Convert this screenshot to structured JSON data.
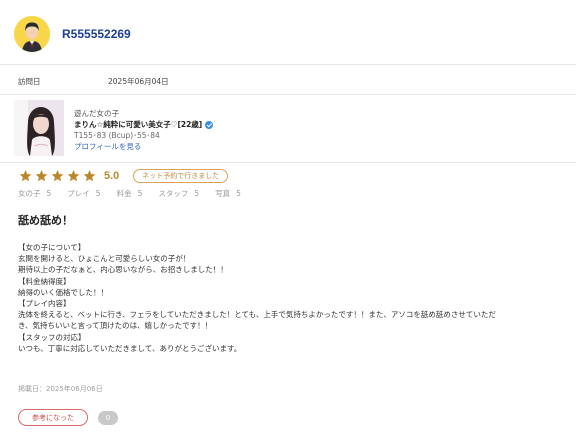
{
  "reviewer": {
    "name": "R555552269",
    "avatar_icon": "user-avatar-icon"
  },
  "visit": {
    "label": "訪問日",
    "date": "2025年06月04日"
  },
  "girl": {
    "section_label": "遊んだ女の子",
    "name": "まりん☆純粋に可愛い美女子♡[22歳]",
    "spec": "T155･83 (Bcup)･55･84",
    "profile_link": "プロフィールを見る",
    "verified_icon": "verified-check-icon"
  },
  "rating": {
    "stars": 5,
    "score": "5.0",
    "badge": "ネット予約で行きました",
    "star_color": "#b98a2b"
  },
  "subscores": [
    {
      "label": "女の子",
      "value": "5"
    },
    {
      "label": "プレイ",
      "value": "5"
    },
    {
      "label": "料金",
      "value": "5"
    },
    {
      "label": "スタッフ",
      "value": "5"
    },
    {
      "label": "写真",
      "value": "5"
    }
  ],
  "review": {
    "title": "舐め舐め！",
    "lines": [
      "【女の子について】",
      "玄関を開けると、ひょこんと可愛らしい女の子が！",
      "期待以上の子だなぁと、内心思いながら、お招きしました！！",
      "【料金納得度】",
      "納得のいく価格でした！！",
      "【プレイ内容】",
      "洗体を終えると、ベットに行き、フェラをしていただきました！とても、上手で気持ちよかったです！！また、アソコを舐め舐めさせていただ",
      "き、気持ちいいと言って頂けたのは、嬉しかったです！！",
      "【スタッフの対応】",
      "いつも、丁寧に対応していただきまして、ありがとうございます。"
    ],
    "post_date": "掲載日：2025年06月06日"
  },
  "helpful": {
    "label": "参考になった",
    "count": "0"
  }
}
